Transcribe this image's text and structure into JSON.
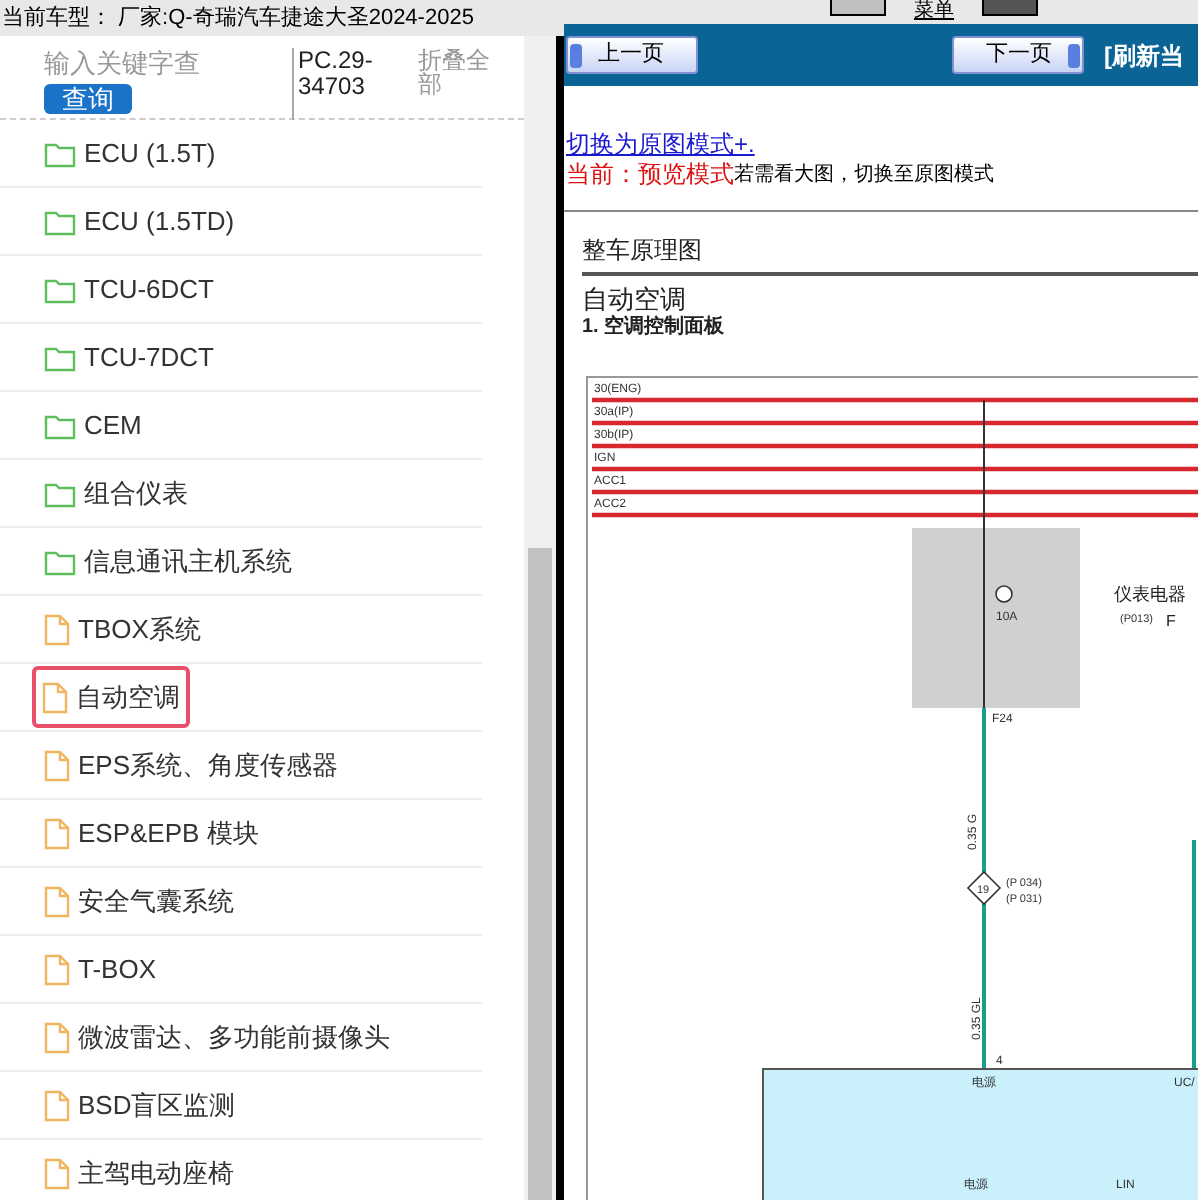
{
  "header": {
    "current_model": "当前车型： 厂家:Q-奇瑞汽车捷途大圣2024-2025",
    "menu_link": "菜单"
  },
  "sidebar": {
    "search": {
      "placeholder": "输入关键字查"
    },
    "search_button": "查询",
    "code": "PC.29-34703",
    "collapse_all": "折叠全部",
    "items": [
      {
        "label": "ECU (1.5T)",
        "kind": "folder",
        "selected": false
      },
      {
        "label": "ECU (1.5TD)",
        "kind": "folder",
        "selected": false
      },
      {
        "label": "TCU-6DCT",
        "kind": "folder",
        "selected": false
      },
      {
        "label": "TCU-7DCT",
        "kind": "folder",
        "selected": false
      },
      {
        "label": "CEM",
        "kind": "folder",
        "selected": false
      },
      {
        "label": "组合仪表",
        "kind": "folder",
        "selected": false
      },
      {
        "label": "信息通讯主机系统",
        "kind": "folder",
        "selected": false
      },
      {
        "label": "TBOX系统",
        "kind": "file",
        "selected": false
      },
      {
        "label": "自动空调",
        "kind": "file",
        "selected": true
      },
      {
        "label": "EPS系统、角度传感器",
        "kind": "file",
        "selected": false
      },
      {
        "label": "ESP&EPB 模块",
        "kind": "file",
        "selected": false
      },
      {
        "label": "安全气囊系统",
        "kind": "file",
        "selected": false
      },
      {
        "label": "T-BOX",
        "kind": "file",
        "selected": false
      },
      {
        "label": "微波雷达、多功能前摄像头",
        "kind": "file",
        "selected": false
      },
      {
        "label": "BSD盲区监测",
        "kind": "file",
        "selected": false
      },
      {
        "label": "主驾电动座椅",
        "kind": "file",
        "selected": false
      }
    ]
  },
  "viewer": {
    "prev_button": "上一页",
    "next_button": "下一页",
    "refresh_link": "[刷新当",
    "switch_link": "切换为原图模式+.",
    "mode_label": "当前：预览模式",
    "mode_hint": "若需看大图，切换至原图模式",
    "document": {
      "section": "整车原理图",
      "title": "自动空调",
      "subtitle": "1. 空调控制面板",
      "buses": [
        "30(ENG)",
        "30a(IP)",
        "30b(IP)",
        "IGN",
        "ACC1",
        "ACC2"
      ],
      "fuse_rating": "10A",
      "box_name": "仪表电器",
      "box_connector": "(P013)",
      "box_pin": "F",
      "wire_pin": "F24",
      "wire_1": "0.35 G",
      "splice": "19",
      "splice_refs": [
        "(P 034)",
        "(P 031)"
      ],
      "wire_2": "0.35 GL",
      "module_pin": "4",
      "module_labels": [
        "电源",
        "UC/",
        "电源",
        "LIN"
      ]
    }
  }
}
